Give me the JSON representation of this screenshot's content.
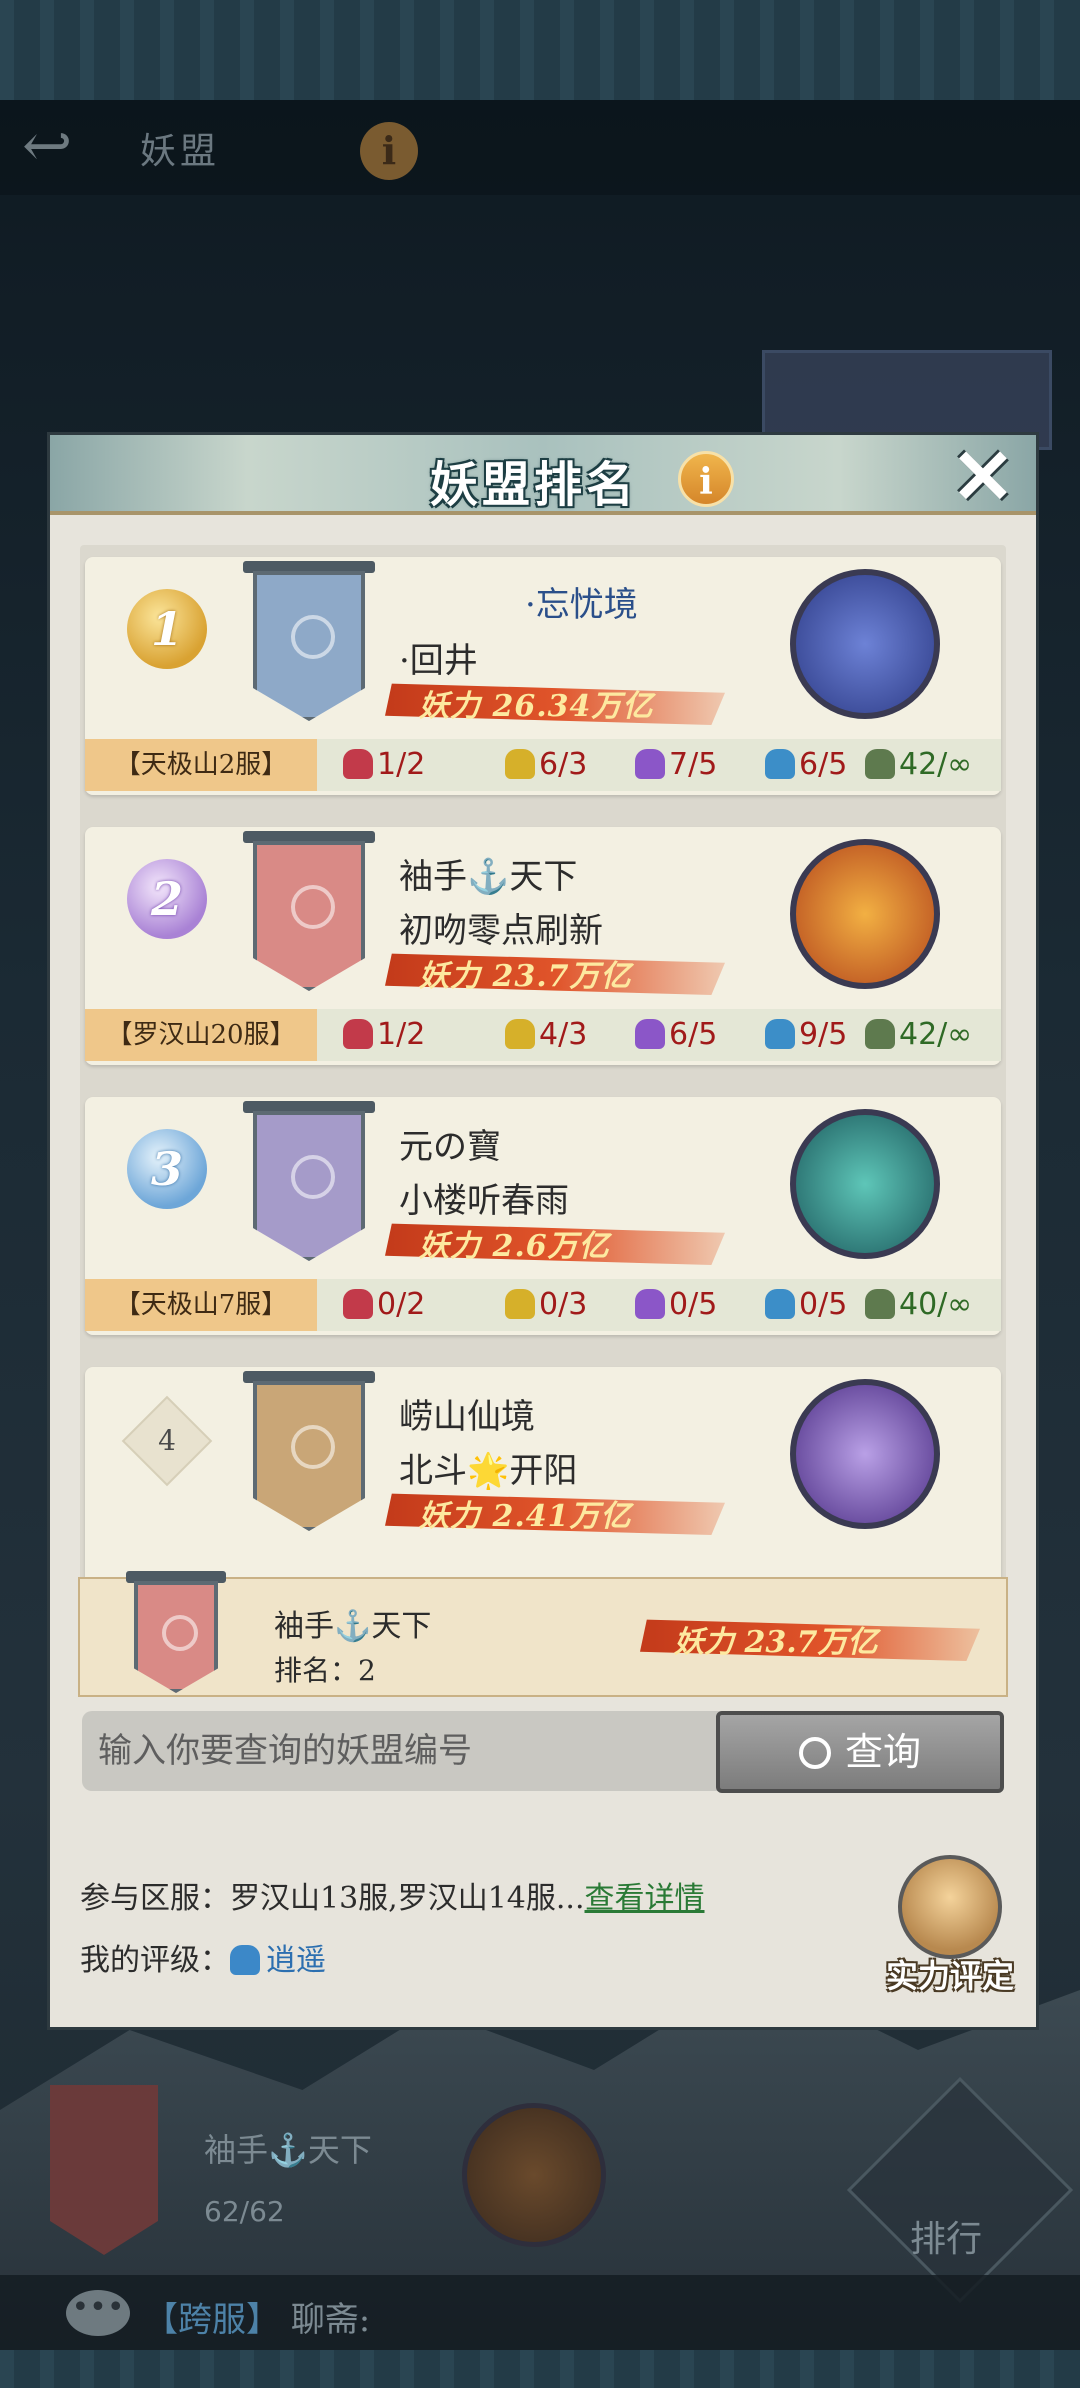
{
  "background": {
    "title": "妖盟",
    "my_guild_name": "袖手⚓天下",
    "my_member_count": "62/62",
    "rank_label": "排行",
    "chat_channel": "【跨服】",
    "chat_label": "聊斋:"
  },
  "modal": {
    "title": "妖盟排名",
    "info_label": "i",
    "close_label": "✕"
  },
  "colors": {
    "power_bar": "#e0542a",
    "server_tag": "#efc78a",
    "stat_red": "#a11a1a",
    "stat_green": "#2f6a26",
    "link_green": "#2a7a36",
    "grade_blue": "#2c6fb0"
  },
  "rankings": [
    {
      "rank": "1",
      "guild_name": "·忘忧境",
      "leader": "·回井",
      "power": "妖力 26.34万亿",
      "server": "【天极山2服】",
      "banner_color": "#8ea9c8",
      "stats": [
        "1/2",
        "6/3",
        "7/5",
        "6/5",
        "42/∞"
      ]
    },
    {
      "rank": "2",
      "guild_name": "袖手⚓天下",
      "leader": "初吻零点刷新",
      "power": "妖力 23.7万亿",
      "server": "【罗汉山20服】",
      "banner_color": "#d98a86",
      "stats": [
        "1/2",
        "4/3",
        "6/5",
        "9/5",
        "42/∞"
      ]
    },
    {
      "rank": "3",
      "guild_name": "元の寶",
      "leader": "小楼听春雨",
      "power": "妖力 2.6万亿",
      "server": "【天极山7服】",
      "banner_color": "#a59bc9",
      "stats": [
        "0/2",
        "0/3",
        "0/5",
        "0/5",
        "40/∞"
      ]
    },
    {
      "rank": "4",
      "guild_name": "崂山仙境",
      "leader": "北斗🌟开阳",
      "power": "妖力 2.41万亿",
      "banner_color": "#c9a677"
    }
  ],
  "my_guild": {
    "name": "袖手⚓天下",
    "rank_text": "排名：2",
    "power": "妖力 23.7万亿"
  },
  "search": {
    "placeholder": "输入你要查询的妖盟编号",
    "button_label": "查询"
  },
  "info": {
    "servers_label": "参与区服：",
    "servers_value": "罗汉山13服,罗汉山14服...",
    "details_link": "查看详情",
    "grade_label": "我的评级：",
    "grade_value": "逍遥",
    "evaluate_label": "实力评定"
  }
}
